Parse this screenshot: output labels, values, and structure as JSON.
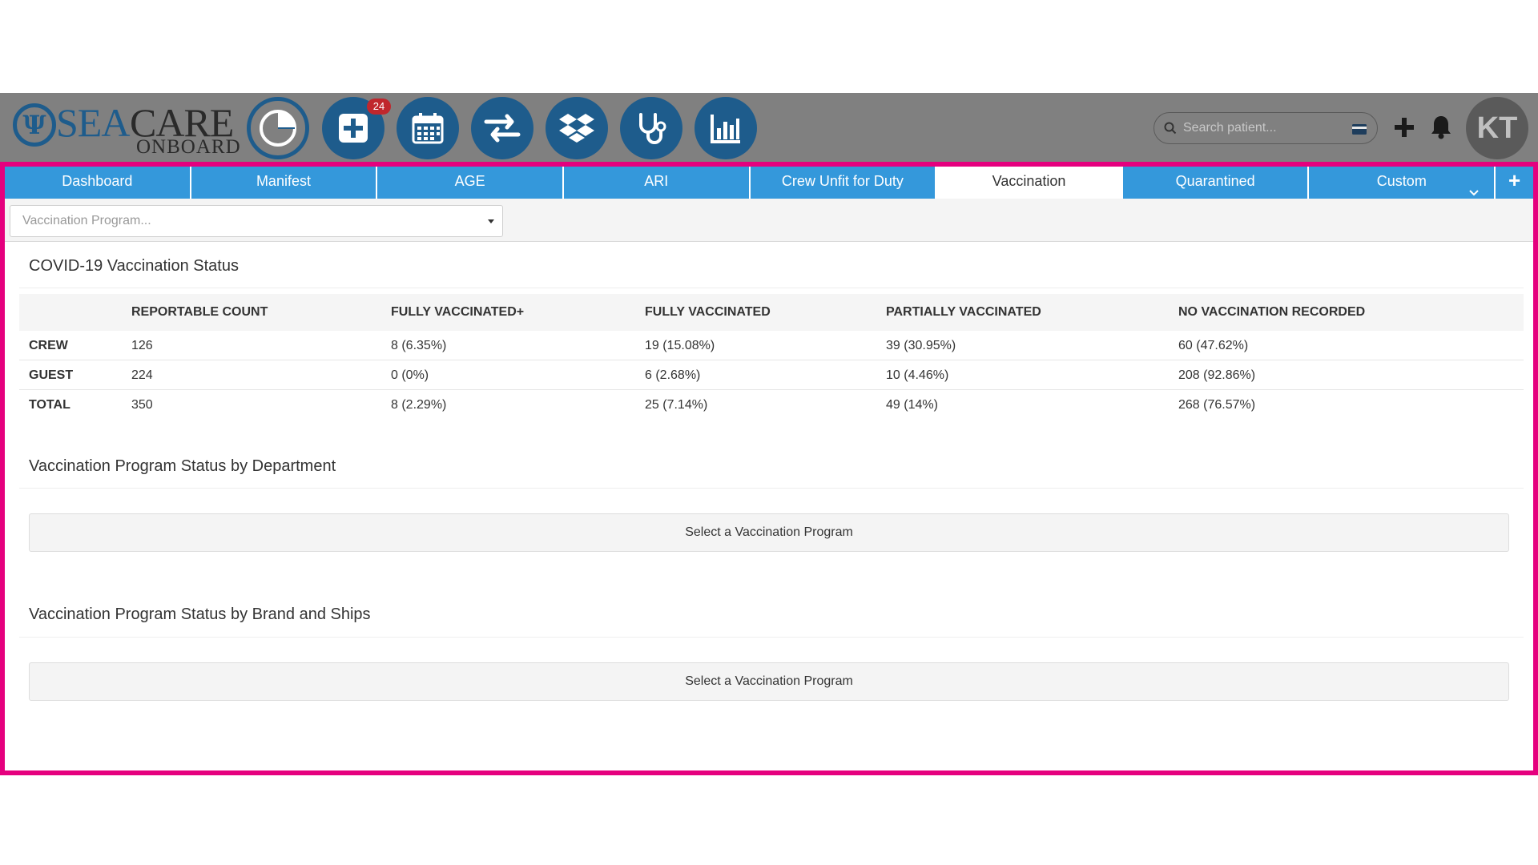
{
  "brand": {
    "sea": "SEA",
    "care": "CARE",
    "onboard": "ONBOARD",
    "emblem": "Ψ",
    "color": "#1e5c8c"
  },
  "toolbar": {
    "icons": [
      {
        "name": "dashboard-pie-icon"
      },
      {
        "name": "medical-add-icon",
        "badge": "24"
      },
      {
        "name": "calendar-icon"
      },
      {
        "name": "transfer-arrows-icon"
      },
      {
        "name": "dropbox-icon"
      },
      {
        "name": "stethoscope-icon"
      },
      {
        "name": "bar-chart-icon"
      }
    ]
  },
  "search": {
    "placeholder": "Search patient..."
  },
  "user": {
    "initials": "KT"
  },
  "tabs": {
    "dashboard": "Dashboard",
    "manifest": "Manifest",
    "age": "AGE",
    "ari": "ARI",
    "crew_unfit": "Crew Unfit for Duty",
    "vaccination": "Vaccination",
    "quarantined": "Quarantined",
    "custom": "Custom",
    "add": "+",
    "active": "Vaccination"
  },
  "filter": {
    "program_placeholder": "Vaccination Program..."
  },
  "covid_section": {
    "title": "COVID-19 Vaccination Status",
    "headers": [
      "",
      "REPORTABLE COUNT",
      "FULLY VACCINATED+",
      "FULLY VACCINATED",
      "PARTIALLY VACCINATED",
      "NO VACCINATION RECORDED"
    ],
    "rows": [
      [
        "CREW",
        "126",
        "8 (6.35%)",
        "19 (15.08%)",
        "39 (30.95%)",
        "60 (47.62%)"
      ],
      [
        "GUEST",
        "224",
        "0 (0%)",
        "6 (2.68%)",
        "10 (4.46%)",
        "208 (92.86%)"
      ],
      [
        "TOTAL",
        "350",
        "8 (2.29%)",
        "25 (7.14%)",
        "49 (14%)",
        "268 (76.57%)"
      ]
    ]
  },
  "department_section": {
    "title": "Vaccination Program Status by Department",
    "placeholder": "Select a Vaccination Program"
  },
  "brand_ships_section": {
    "title": "Vaccination Program Status by Brand and Ships",
    "placeholder": "Select a Vaccination Program"
  },
  "colors": {
    "accent_border": "#e5007e",
    "tab_blue": "#3498db",
    "topbar_gray": "#808080",
    "badge_red": "#c0272d"
  }
}
